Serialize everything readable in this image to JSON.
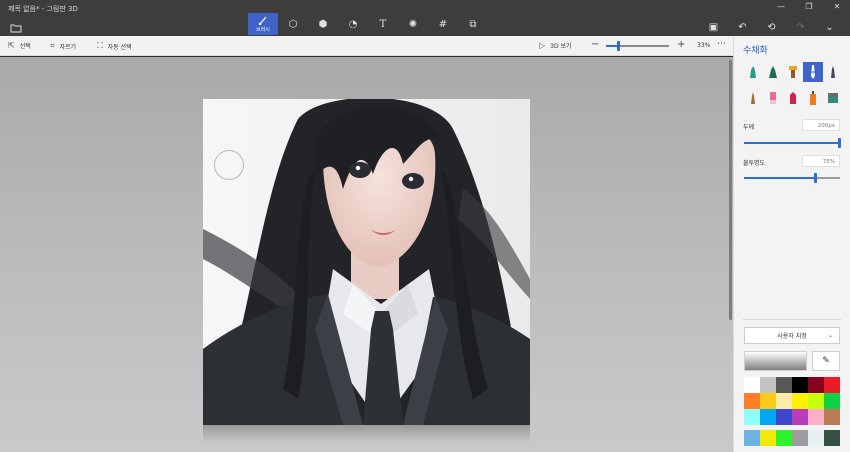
{
  "app": {
    "title": "제목 없음* - 그림판 3D"
  },
  "toolbar": {
    "tools": [
      {
        "name": "brush",
        "label": "브러시",
        "active": true,
        "icon": "brush-icon"
      },
      {
        "name": "2d-shapes",
        "icon": "2d-shapes-icon"
      },
      {
        "name": "3d-shapes",
        "icon": "3d-shapes-icon"
      },
      {
        "name": "stickers",
        "icon": "stickers-icon"
      },
      {
        "name": "text",
        "icon": "text-icon"
      },
      {
        "name": "effects",
        "icon": "effects-icon"
      },
      {
        "name": "canvas",
        "icon": "canvas-icon"
      },
      {
        "name": "3d-library",
        "icon": "3d-library-icon"
      }
    ],
    "right": [
      "paste-icon",
      "undo-icon",
      "history-icon",
      "redo-icon",
      "expand-icon"
    ]
  },
  "subbar": {
    "select": "선택",
    "crop": "자르기",
    "magic_select": "자동 선택",
    "view3d": "3D 보기",
    "zoom_value": "33%",
    "zoom_level": 0.2
  },
  "panel": {
    "title": "수채화",
    "thickness_label": "두께",
    "thickness_value": "200px",
    "thickness_level": 1.0,
    "opacity_label": "불투명도",
    "opacity_value": "75%",
    "opacity_level": 0.75,
    "preset_label": "사용자 지정",
    "colors": {
      "accent": "#3f63c9",
      "palette": [
        "#ffffff",
        "#c3c3c3",
        "#585858",
        "#000000",
        "#88001b",
        "#ec1c24",
        "#ff7f27",
        "#ffca18",
        "#fdeca6",
        "#fff200",
        "#c4ff0e",
        "#0ed145",
        "#8cfffb",
        "#00a8f3",
        "#3f48cc",
        "#b83dba",
        "#ffaec8",
        "#b97a56"
      ],
      "custom": [
        "#6fb3e0",
        "#f1e90b",
        "#2ff22f",
        "#9c9c9c",
        "#e9f0f3",
        "#355245"
      ]
    }
  }
}
